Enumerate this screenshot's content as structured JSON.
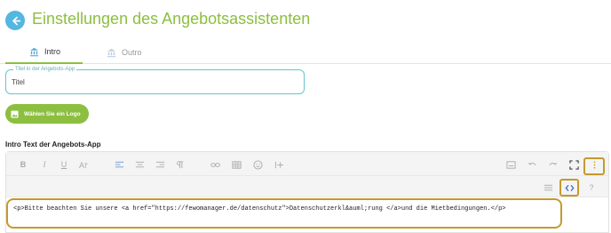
{
  "header": {
    "title": "Einstellungen des Angebotsassistenten",
    "back_icon": "arrow-left-icon",
    "title_color": "#8cbf3f"
  },
  "tabs": [
    {
      "label": "Intro",
      "icon": "bank-icon",
      "active": true
    },
    {
      "label": "Outro",
      "icon": "bank-icon",
      "active": false
    }
  ],
  "title_field": {
    "legend": "Titel in der Angebots-App",
    "value": "Titel",
    "border_color": "#68c4cf"
  },
  "logo_button": {
    "label": "Wählen Sie ein Logo",
    "icon": "image-icon",
    "color": "#8cbf3f"
  },
  "intro_section": {
    "label": "Intro Text der Angebots-App"
  },
  "editor": {
    "toolbar_row1": [
      "bold",
      "italic",
      "underline",
      "font-size",
      "align-left",
      "align-center",
      "align-right",
      "paragraph",
      "link",
      "table",
      "emoji",
      "horizontal-rule",
      "image",
      "undo",
      "redo",
      "fullscreen",
      "more-vertical"
    ],
    "toolbar_row2": [
      "select-all",
      "code-view",
      "help"
    ],
    "toolbar_glyphs": {
      "bold": "B",
      "italic": "I",
      "underline": "U",
      "help": "?"
    },
    "code_content": "<p>Bitte beachten Sie unsere <a href=\"https://fewomanager.de/datenschutz\">Datenschutzerkl&auml;rung </a>und die Mietbedingungen.</p>",
    "highlight_color": "#c49a2e"
  }
}
